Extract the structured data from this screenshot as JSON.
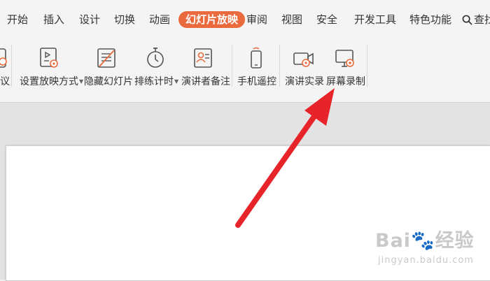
{
  "menu": {
    "tabs": [
      "开始",
      "插入",
      "设计",
      "切换",
      "动画",
      "幻灯片放映",
      "审阅",
      "视图",
      "安全",
      "开发工具",
      "特色功能"
    ],
    "active_tab": "幻灯片放映",
    "search_label": "查找"
  },
  "ribbon": {
    "partial_left_label": "议",
    "tools": [
      {
        "label": "设置放映方式",
        "icon": "slideshow-settings-icon",
        "has_dropdown": true
      },
      {
        "label": "隐藏幻灯片",
        "icon": "hide-slide-icon",
        "has_dropdown": false
      },
      {
        "label": "排练计时",
        "icon": "stopwatch-icon",
        "has_dropdown": true
      },
      {
        "label": "演讲者备注",
        "icon": "speaker-notes-icon",
        "has_dropdown": false
      },
      {
        "label": "手机遥控",
        "icon": "phone-remote-icon",
        "has_dropdown": false
      },
      {
        "label": "演讲实录",
        "icon": "video-record-icon",
        "has_dropdown": false
      },
      {
        "label": "屏幕录制",
        "icon": "screen-record-icon",
        "has_dropdown": false
      }
    ]
  },
  "colors": {
    "accent": "#ea6a3d",
    "annotation_arrow": "#e8242b"
  },
  "watermark": {
    "brand": "Bai",
    "brand_suffix": "经验",
    "url": "jingyan.baidu.com"
  }
}
